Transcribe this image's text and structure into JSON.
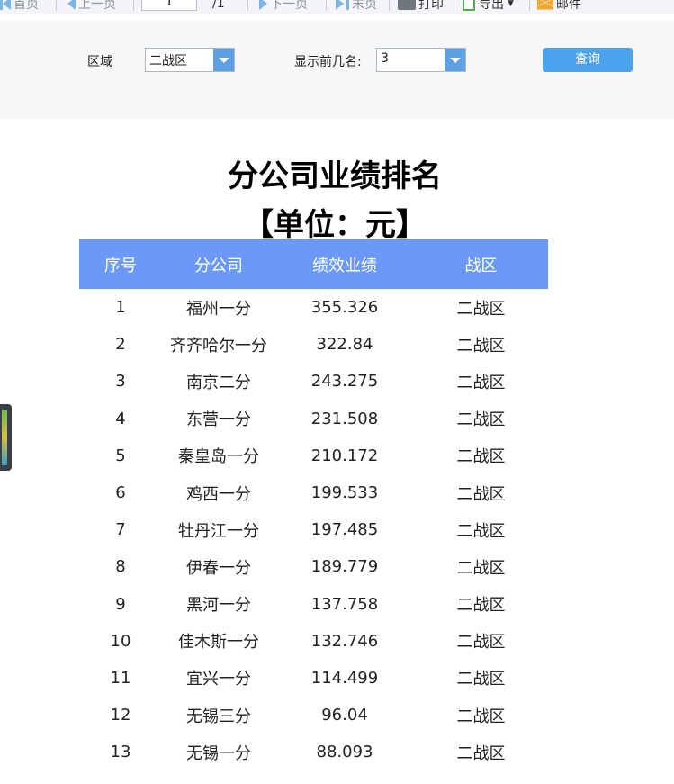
{
  "toolbar": {
    "first_page": "首页",
    "prev_page": "上一页",
    "page_current": "1",
    "page_total": "/1",
    "next_page": "下一页",
    "last_page": "末页",
    "print": "打印",
    "export": "导出",
    "mail": "邮件"
  },
  "filter": {
    "region_label": "区域",
    "region_value": "二战区",
    "topn_label": "显示前几名:",
    "topn_value": "3",
    "query_label": "查询"
  },
  "report": {
    "title": "分公司业绩排名",
    "subtitle": "【单位：元】",
    "columns": [
      "序号",
      "分公司",
      "绩效业绩",
      "战区"
    ],
    "rows": [
      [
        "1",
        "福州一分",
        "355.326",
        "二战区"
      ],
      [
        "2",
        "齐齐哈尔一分",
        "322.84",
        "二战区"
      ],
      [
        "3",
        "南京二分",
        "243.275",
        "二战区"
      ],
      [
        "4",
        "东营一分",
        "231.508",
        "二战区"
      ],
      [
        "5",
        "秦皇岛一分",
        "210.172",
        "二战区"
      ],
      [
        "6",
        "鸡西一分",
        "199.533",
        "二战区"
      ],
      [
        "7",
        "牡丹江一分",
        "197.485",
        "二战区"
      ],
      [
        "8",
        "伊春一分",
        "189.779",
        "二战区"
      ],
      [
        "9",
        "黑河一分",
        "137.758",
        "二战区"
      ],
      [
        "10",
        "佳木斯一分",
        "132.746",
        "二战区"
      ],
      [
        "11",
        "宜兴一分",
        "114.499",
        "二战区"
      ],
      [
        "12",
        "无锡三分",
        "96.04",
        "二战区"
      ],
      [
        "13",
        "无锡一分",
        "88.093",
        "二战区"
      ]
    ]
  },
  "colors": {
    "header_bg": "#6c99f6",
    "button_bg": "#4aa3ec",
    "toolbar_icon": "#7db4e6"
  }
}
